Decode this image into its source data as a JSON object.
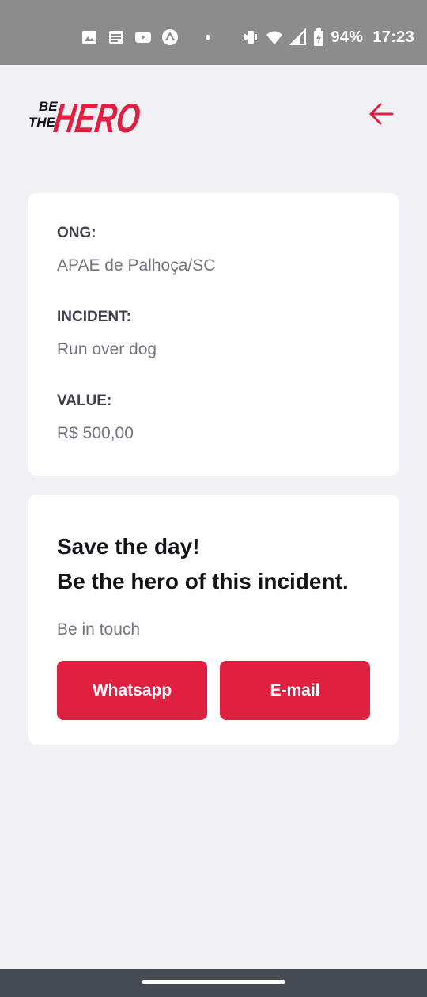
{
  "status_bar": {
    "battery": "94%",
    "time": "17:23",
    "icons": [
      "image-icon",
      "news-icon",
      "youtube-icon",
      "expo-icon",
      "dot-icon",
      "dot-icon",
      "vibrate-icon",
      "wifi-icon",
      "signal-icon",
      "battery-icon"
    ]
  },
  "header": {
    "logo_line1": "BE",
    "logo_line2": "THE",
    "logo_word": "HERO",
    "back_icon": "arrow-left-icon"
  },
  "incident": {
    "ong_label": "ONG:",
    "ong_value": "APAE de Palhoça/SC",
    "incident_label": "INCIDENT:",
    "incident_value": "Run over dog",
    "value_label": "VALUE:",
    "value_value": "R$ 500,00"
  },
  "contact": {
    "title_line1": "Save the day!",
    "title_line2": "Be the hero of this incident.",
    "description": "Be in touch",
    "whatsapp_label": "Whatsapp",
    "email_label": "E-mail"
  },
  "colors": {
    "accent": "#e02041",
    "background": "#f0f0f5",
    "card": "#ffffff",
    "label": "#41414d",
    "value": "#737380",
    "title": "#13131a"
  }
}
